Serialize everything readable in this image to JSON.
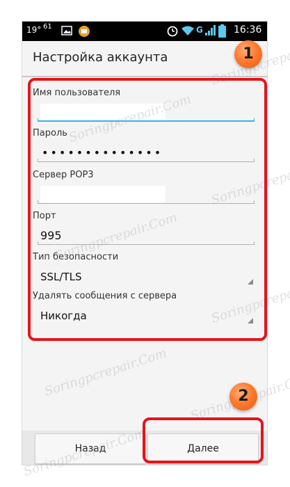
{
  "status_bar": {
    "left_text": "19°",
    "speed_text": "61",
    "network": "G",
    "time": "16:36"
  },
  "action_bar": {
    "title": "Настройка аккаунта"
  },
  "form": {
    "username_label": "Имя пользователя",
    "username_value": "",
    "password_label": "Пароль",
    "password_value": "••••••••••••••",
    "pop3_label": "Сервер POP3",
    "pop3_value": "",
    "port_label": "Порт",
    "port_value": "995",
    "security_label": "Тип безопасности",
    "security_value": "SSL/TLS",
    "delete_label": "Удалять сообщения с сервера",
    "delete_value": "Никогда"
  },
  "buttons": {
    "back": "Назад",
    "next": "Далее"
  },
  "badges": {
    "one": "1",
    "two": "2"
  },
  "watermark": "Soringpcrepair.Com",
  "colors": {
    "accent": "#33b5e5",
    "highlight": "#e4141c",
    "badge": "#ff7b2e"
  }
}
